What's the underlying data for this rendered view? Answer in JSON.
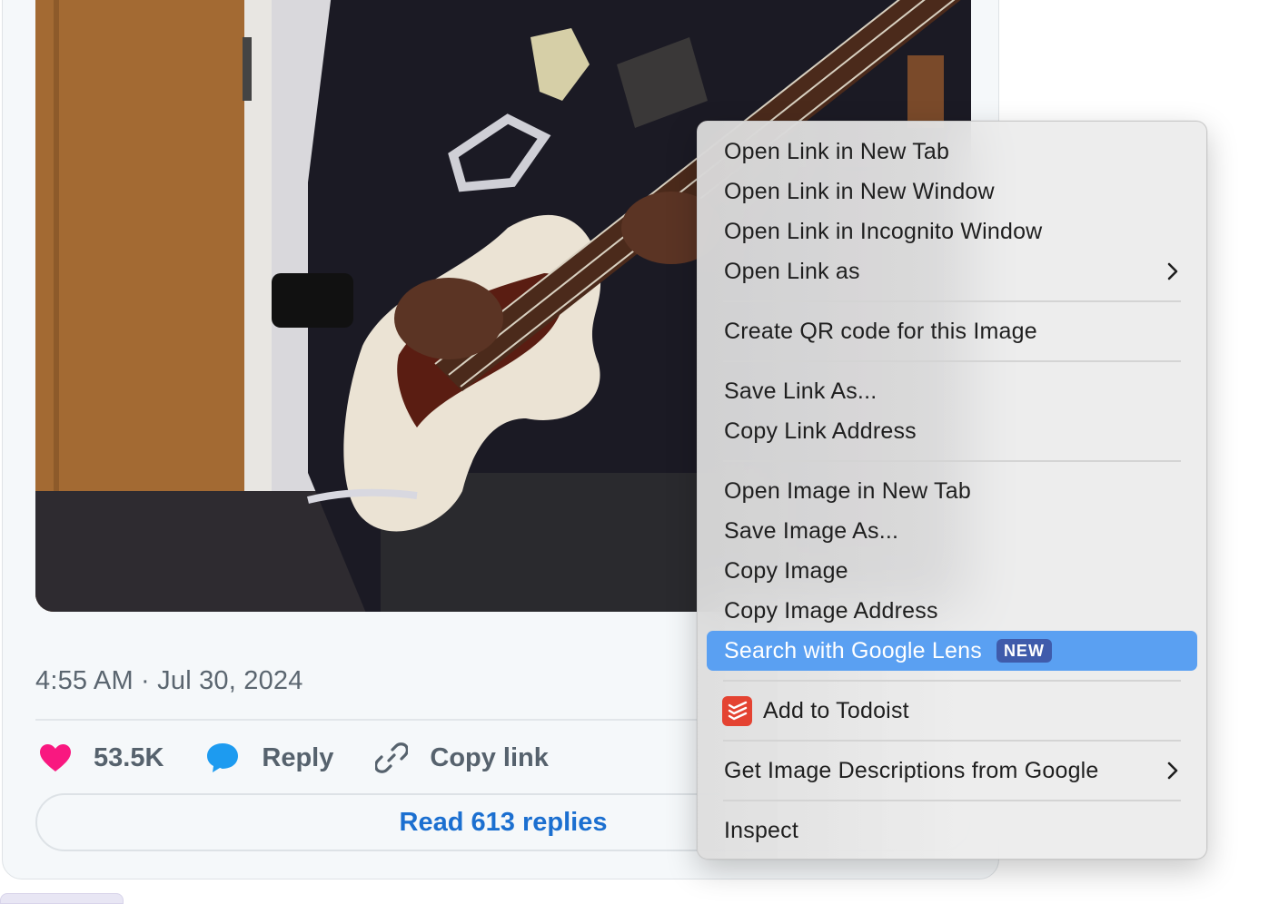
{
  "tweet": {
    "timestamp": "4:55 AM · Jul 30, 2024",
    "likes": "53.5K",
    "reply_label": "Reply",
    "copy_link_label": "Copy link",
    "read_replies_label": "Read 613 replies",
    "icons": {
      "like": "heart-icon",
      "reply": "speech-bubble-icon",
      "copy_link": "link-icon"
    },
    "colors": {
      "heart": "#f91880",
      "reply": "#1d9bf0",
      "link_text": "#1b6fd0"
    }
  },
  "context_menu": {
    "items": [
      {
        "label": "Open Link in New Tab"
      },
      {
        "label": "Open Link in New Window"
      },
      {
        "label": "Open Link in Incognito Window"
      },
      {
        "label": "Open Link as",
        "submenu": true
      },
      {
        "label": "Create QR code for this Image"
      },
      {
        "label": "Save Link As..."
      },
      {
        "label": "Copy Link Address"
      },
      {
        "label": "Open Image in New Tab"
      },
      {
        "label": "Save Image As..."
      },
      {
        "label": "Copy Image"
      },
      {
        "label": "Copy Image Address"
      },
      {
        "label": "Search with Google Lens",
        "badge": "NEW",
        "highlighted": true
      },
      {
        "label": "Add to Todoist",
        "icon": "todoist-icon"
      },
      {
        "label": "Get Image Descriptions from Google",
        "submenu": true
      },
      {
        "label": "Inspect"
      }
    ],
    "highlight_color": "#5aa0f2",
    "badge_color": "#3f5bab"
  }
}
